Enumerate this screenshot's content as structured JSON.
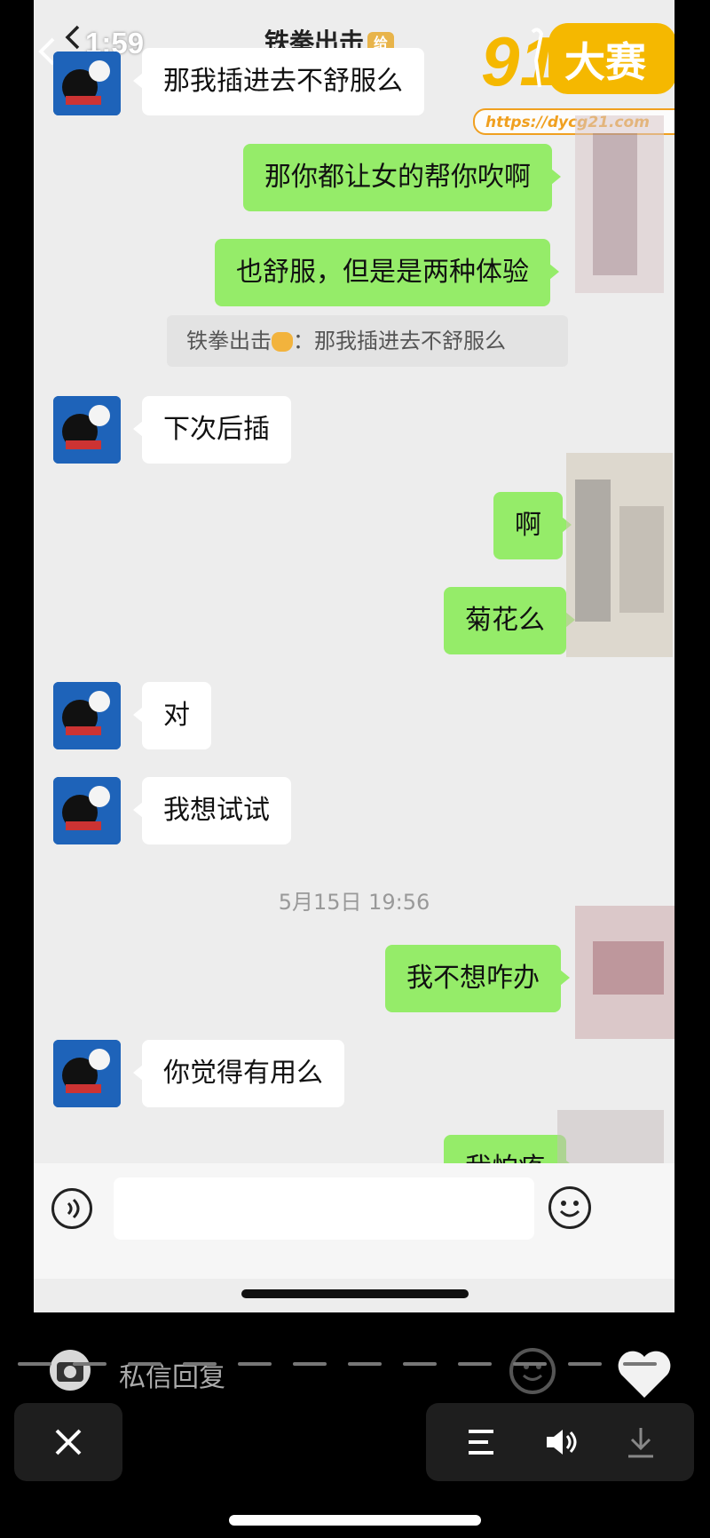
{
  "status_bar": {
    "time": "1:59"
  },
  "chat": {
    "title": "铁拳出击",
    "title_badge": "给"
  },
  "watermark": {
    "logo_number": "91",
    "logo_text": "大赛",
    "url": "https://dycg21.com"
  },
  "messages": [
    {
      "side": "left",
      "text": "那我插进去不舒服么"
    },
    {
      "side": "right",
      "text": "那你都让女的帮你吹啊"
    },
    {
      "side": "right",
      "text": "也舒服，但是是两种体验"
    },
    {
      "side": "quote",
      "author": "铁拳出击",
      "text": "：那我插进去不舒服么"
    },
    {
      "side": "left",
      "text": "下次后插"
    },
    {
      "side": "right",
      "text": "啊"
    },
    {
      "side": "right",
      "text": "菊花么"
    },
    {
      "side": "left",
      "text": "对"
    },
    {
      "side": "left",
      "text": "我想试试"
    },
    {
      "side": "right",
      "text": "我不想咋办"
    },
    {
      "side": "left",
      "text": "你觉得有用么"
    },
    {
      "side": "right",
      "text": "我怕疼"
    }
  ],
  "timestamp": "5月15日 19:56",
  "input": {
    "placeholder": ""
  },
  "bottom": {
    "dm_placeholder": "私信回复",
    "controls": [
      "menu-icon",
      "volume-icon",
      "download-icon"
    ]
  },
  "colors": {
    "bubble_right": "#95ec69",
    "bubble_left": "#ffffff",
    "chat_bg": "#ededed",
    "logo": "#f5b800"
  }
}
